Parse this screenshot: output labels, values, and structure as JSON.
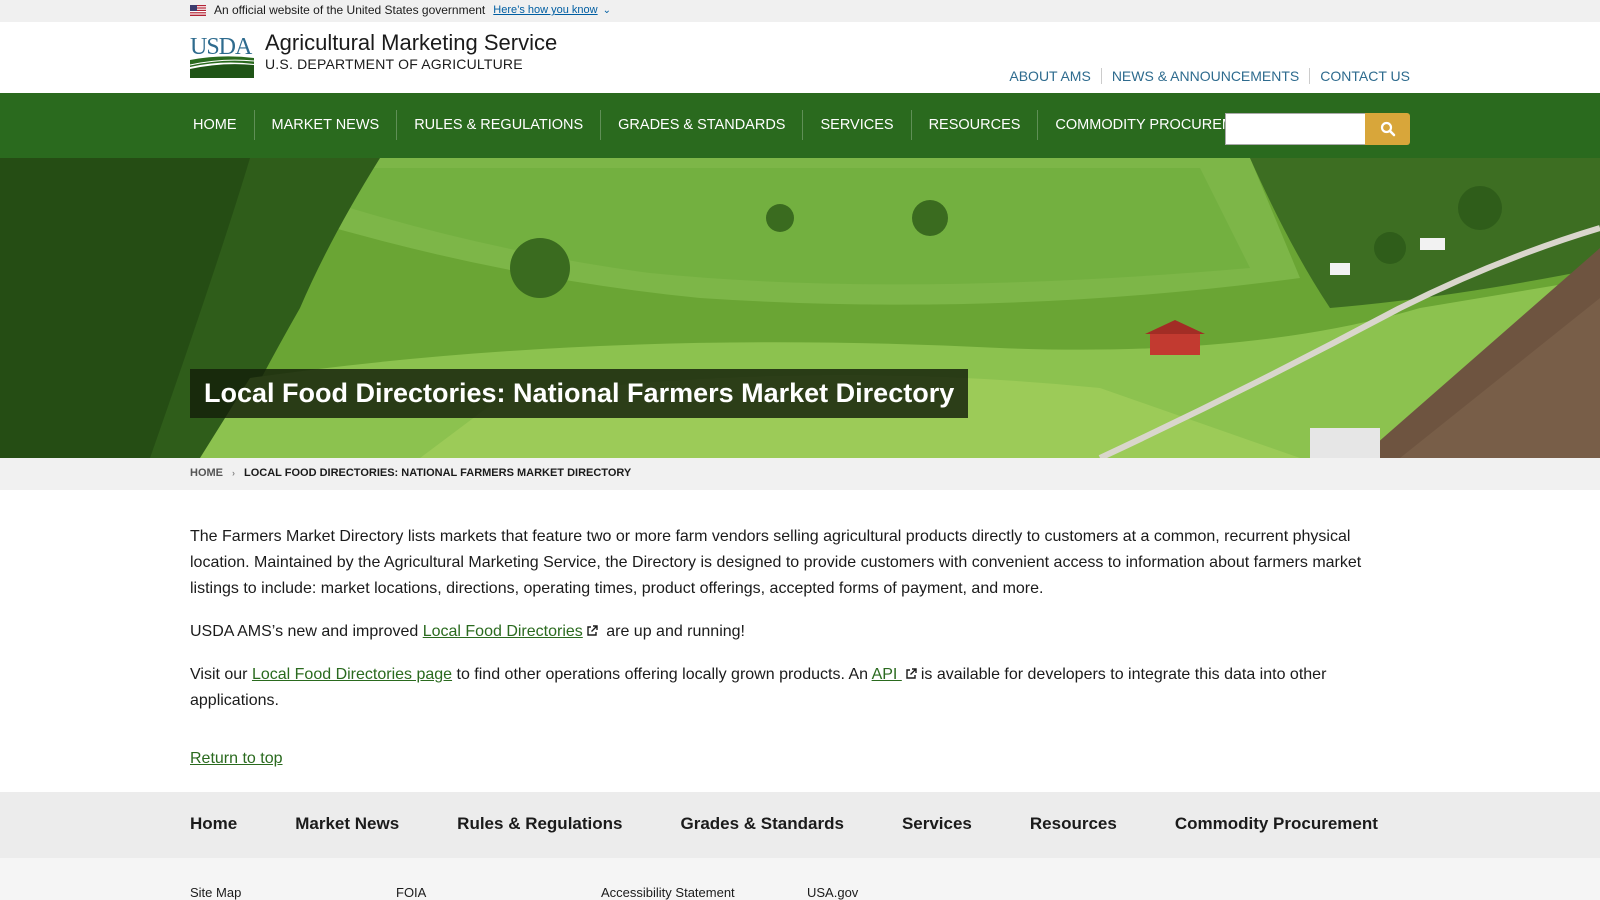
{
  "gov_banner": {
    "text": "An official website of the United States government",
    "link": "Here’s how you know"
  },
  "header": {
    "agency_name": "Agricultural Marketing Service",
    "department": "U.S. DEPARTMENT OF AGRICULTURE",
    "logo_text": "USDA",
    "utility_nav": [
      "ABOUT AMS",
      "NEWS & ANNOUNCEMENTS",
      "CONTACT US"
    ]
  },
  "main_nav": {
    "items": [
      "HOME",
      "MARKET NEWS",
      "RULES & REGULATIONS",
      "GRADES & STANDARDS",
      "SERVICES",
      "RESOURCES",
      "COMMODITY PROCUREMENT"
    ],
    "search_placeholder": ""
  },
  "hero": {
    "title": "Local Food Directories: National Farmers Market Directory"
  },
  "breadcrumb": {
    "home": "HOME",
    "separator": "›",
    "current": "LOCAL FOOD DIRECTORIES: NATIONAL FARMERS MARKET DIRECTORY"
  },
  "content": {
    "p1": "The Farmers Market Directory lists markets that feature two or more farm vendors selling agricultural products directly to customers at a common, recurrent physical location. Maintained by the Agricultural Marketing Service, the Directory is designed to provide customers with convenient access to information about farmers market listings to include: market locations, directions, operating times, product offerings, accepted forms of payment, and more.",
    "p2_before": "USDA AMS’s new and improved ",
    "p2_link": "Local Food Directories",
    "p2_after": " are up and running!",
    "p3_before": "Visit our ",
    "p3_link1": "Local Food Directories page",
    "p3_middle": " to find other operations offering locally grown products. An ",
    "p3_link2": "API ",
    "p3_after": "is available for developers to integrate this data into other applications.",
    "return_top": "Return to top"
  },
  "footer": {
    "nav": [
      "Home",
      "Market News",
      "Rules & Regulations",
      "Grades & Standards",
      "Services",
      "Resources",
      "Commodity Procurement"
    ],
    "links": [
      "Site Map",
      "FOIA",
      "Accessibility Statement",
      "USA.gov"
    ]
  },
  "colors": {
    "nav_green": "#2a6a1e",
    "search_gold": "#d8a63a",
    "link_blue": "#2e6b8e"
  }
}
